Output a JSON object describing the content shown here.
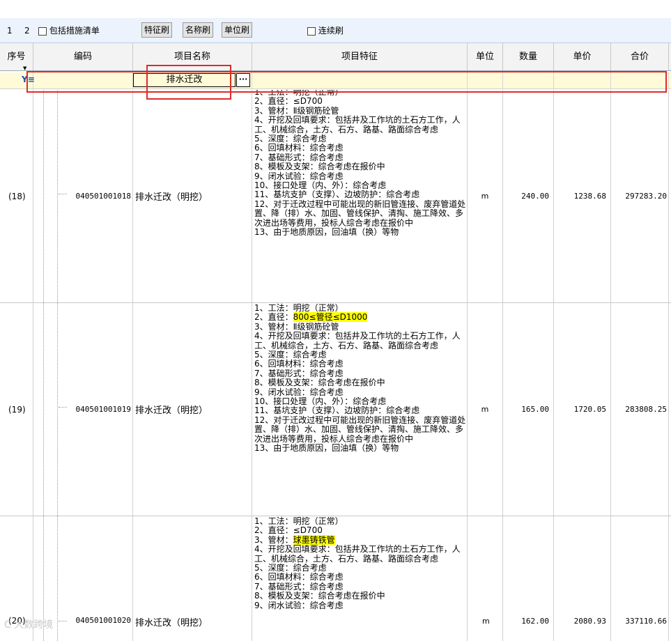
{
  "toolbar": {
    "level_1": "1",
    "level_2": "2",
    "include_measures_label": "包括措施清单",
    "feature_brush": "特征刷",
    "name_brush": "名称刷",
    "unit_brush": "单位刷",
    "continuous_brush_label": "连续刷"
  },
  "columns": {
    "seq": "序号",
    "code": "编码",
    "name": "项目名称",
    "feature": "项目特征",
    "unit": "单位",
    "qty": "数量",
    "price": "单价",
    "total": "合价"
  },
  "filter": {
    "name_value": "排水迁改",
    "ellipsis": "···"
  },
  "rows": [
    {
      "seq": "(18)",
      "code": "040501001018",
      "name": "排水迁改（明挖）",
      "unit": "m",
      "qty": "240.00",
      "price": "1238.68",
      "total": "297283.20",
      "f1": "1、工法：明挖（正常）",
      "f2a": "2、直径：≤D700",
      "f2b": "",
      "f3a": "3、管材：Ⅱ级钢筋砼管",
      "f3b": "",
      "rest": "4、开挖及回填要求：包括井及工作坑的土石方工作，人工、机械综合，土方、石方、路基、路面综合考虑\n5、深度：综合考虑\n6、回填材料：综合考虑\n7、基础形式：综合考虑\n8、模板及支架：综合考虑在报价中\n9、闭水试验：综合考虑\n10、接口处理（内、外）：综合考虑\n11、基坑支护（支撑）、边坡防护：综合考虑\n12、对于迁改过程中可能出现的新旧管连接、废弃管道处置、降（排）水、加固、管线保护、清掏、施工降效、多次进出场等费用，投标人综合考虑在报价中\n13、由于地质原因，回油填（换）等物"
    },
    {
      "seq": "(19)",
      "code": "040501001019",
      "name": "排水迁改（明挖）",
      "unit": "m",
      "qty": "165.00",
      "price": "1720.05",
      "total": "283808.25",
      "f1": "1、工法：明挖（正常）",
      "f2a": "2、直径：",
      "f2b": "800≤管径≤D1000",
      "f3a": "3、管材：Ⅱ级钢筋砼管",
      "f3b": "",
      "rest": "4、开挖及回填要求：包括井及工作坑的土石方工作，人工、机械综合，土方、石方、路基、路面综合考虑\n5、深度：综合考虑\n6、回填材料：综合考虑\n7、基础形式：综合考虑\n8、模板及支架：综合考虑在报价中\n9、闭水试验：综合考虑\n10、接口处理（内、外）：综合考虑\n11、基坑支护（支撑）、边坡防护：综合考虑\n12、对于迁改过程中可能出现的新旧管连接、废弃管道处置、降（排）水、加固、管线保护、清掏、施工降效、多次进出场等费用，投标人综合考虑在报价中\n13、由于地质原因，回油填（换）等物"
    },
    {
      "seq": "(20)",
      "code": "040501001020",
      "name": "排水迁改（明挖）",
      "unit": "m",
      "qty": "162.00",
      "price": "2080.93",
      "total": "337110.66",
      "f1": "1、工法：明挖（正常）",
      "f2a": "2、直径：≤D700",
      "f2b": "",
      "f3a": "3、管材：",
      "f3b": "球墨铸铁管",
      "rest": "4、开挖及回填要求：包括井及工作坑的土石方工作，人工、机械综合，土方、石方、路基、路面综合考虑\n5、深度：综合考虑\n6、回填材料：综合考虑\n7、基础形式：综合考虑\n8、模板及支架：综合考虑在报价中\n9、闭水试验：综合考虑"
    }
  ],
  "watermark": "C 大数跨境",
  "colors": {
    "highlight": "#ffff00",
    "annotation": "#e02a2a",
    "filter_row": "#fffbd8",
    "toolbar": "#ecf3fc"
  }
}
